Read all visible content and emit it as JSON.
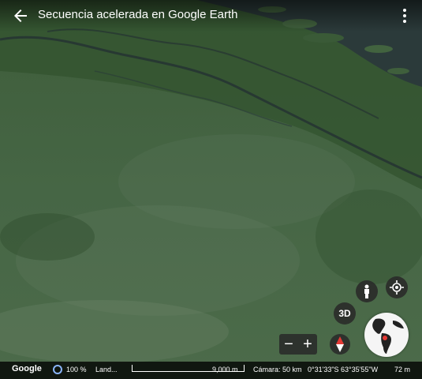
{
  "header": {
    "title": "Secuencia acelerada en Google Earth"
  },
  "controls": {
    "btn_3d": "3D",
    "zoom_out": "−",
    "zoom_in": "+"
  },
  "status_bar": {
    "logo": "Google",
    "zoom_percent": "100 %",
    "layer": "Land...",
    "scale_label": "9,000 m",
    "camera": "Cámara: 50 km",
    "coordinates": "0°31'33\"S 63°35'55\"W",
    "elevation": "72 m"
  },
  "icons": [
    "back-arrow-icon",
    "more-vert-icon",
    "pegman-icon",
    "my-location-icon",
    "compass-icon",
    "globe-icon",
    "loading-ring-icon"
  ],
  "colors": {
    "forest": "#3b5a35",
    "river": "#2a3b3a",
    "bar_bg": "#000000",
    "accent": "#8ab4f8"
  }
}
